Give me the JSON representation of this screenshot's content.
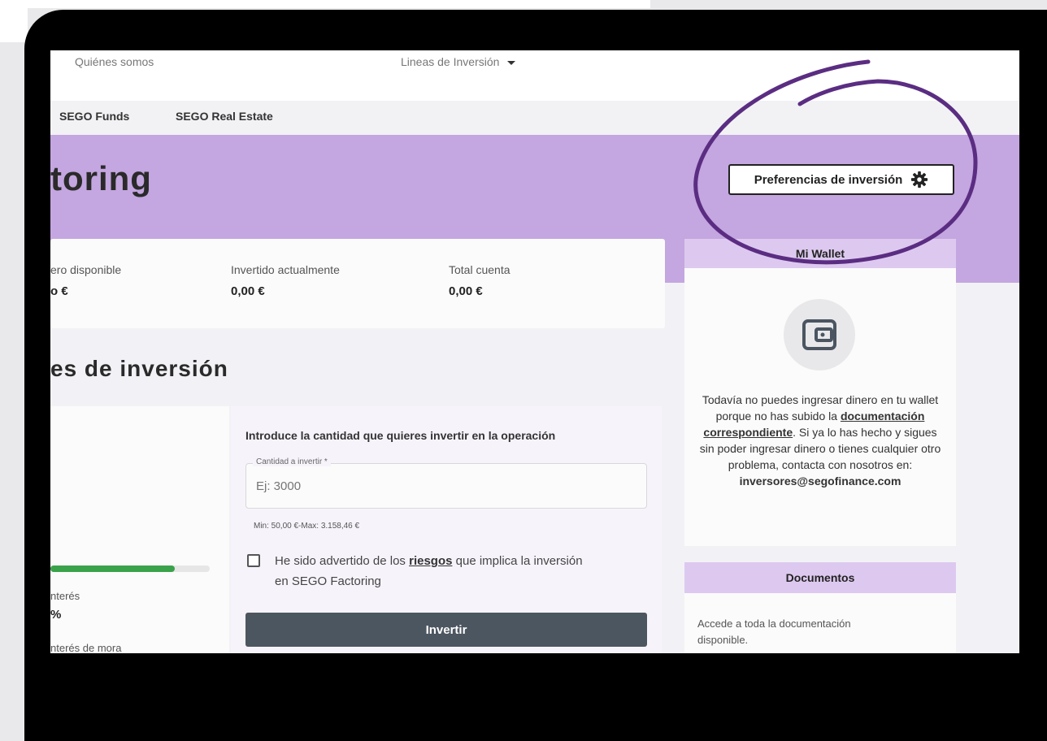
{
  "nav": {
    "quienes": "Quiénes somos",
    "lineas": "Lineas de Inversión"
  },
  "subnav": {
    "funds": "SEGO Funds",
    "realestate": "SEGO Real Estate"
  },
  "hero": {
    "title": "toring",
    "preferences_button": "Preferencias de inversión"
  },
  "stats": [
    {
      "label": "ero disponible",
      "value": "o €"
    },
    {
      "label": "Invertido actualmente",
      "value": "0,00 €"
    },
    {
      "label": "Total cuenta",
      "value": "0,00 €"
    }
  ],
  "section_title": "es de inversión",
  "left_card": {
    "progress": 0.78,
    "interes_label": "nterés",
    "interes_value": "%",
    "mora_label": "nterés de mora"
  },
  "form": {
    "title": "Introduce la cantidad que quieres invertir en la operación",
    "field_label": "Cantidad a invertir *",
    "field_placeholder": "Ej: 3000",
    "minmax": "Min: 50,00 €-Max: 3.158,46 €",
    "check_part1": "He sido advertido de los",
    "check_link": "riesgos",
    "check_part2": "que implica la inversión en SEGO Factoring",
    "invest_button": "Invertir"
  },
  "wallet": {
    "title": "Mi Wallet",
    "text_part1": "Todavía no puedes ingresar dinero en tu wallet porque no has subido la",
    "doc_link": "documentación correspondiente",
    "text_part2": ". Si ya lo has hecho y sigues sin poder ingresar dinero o tienes cualquier otro problema, contacta con nosotros en:",
    "email": "inversores@segofinance.com"
  },
  "docs": {
    "title": "Documentos",
    "text": "Accede a toda la documentación disponible."
  },
  "colors": {
    "hero": "#c4a6e0",
    "card_header": "#ddc9ef",
    "invest_button": "#4c5660",
    "annotation": "#5b2d82",
    "progress": "#3aa24a"
  }
}
